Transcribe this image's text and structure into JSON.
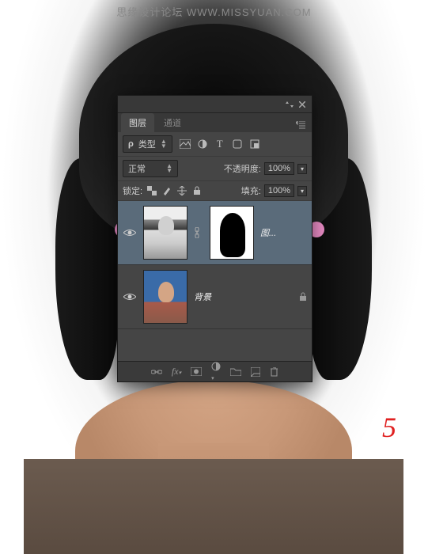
{
  "watermark": "思缘设计论坛  WWW.MISSYUAN.COM",
  "annotation": "5",
  "panel": {
    "tabs": {
      "layers": "图层",
      "channels": "通道"
    },
    "filter": {
      "kind_label": "类型"
    },
    "blend": {
      "mode": "正常",
      "opacity_label": "不透明度:",
      "opacity_value": "100%"
    },
    "lock": {
      "label": "锁定:",
      "fill_label": "填充:",
      "fill_value": "100%"
    },
    "layers": [
      {
        "name": "图...",
        "selected": true,
        "has_mask": true,
        "locked": false
      },
      {
        "name": "背景",
        "selected": false,
        "has_mask": false,
        "locked": true
      }
    ]
  }
}
